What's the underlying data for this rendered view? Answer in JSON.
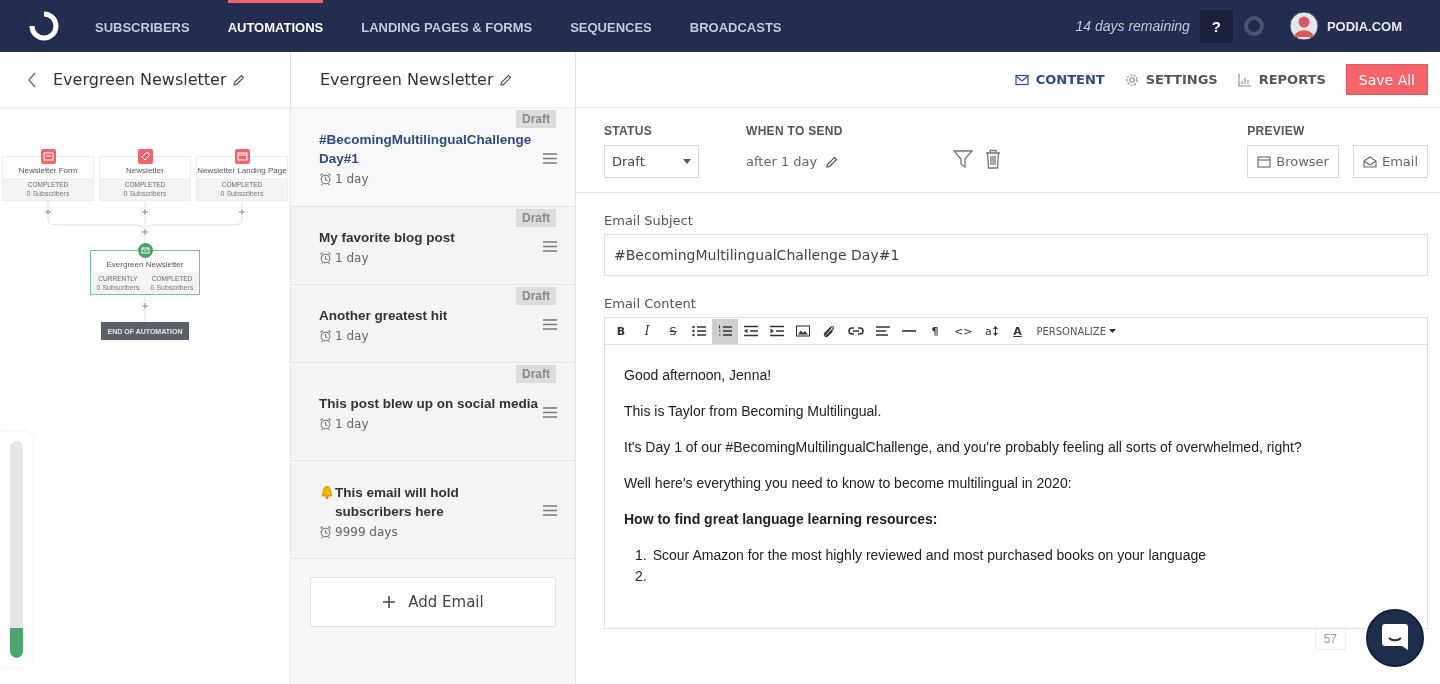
{
  "nav": {
    "items": [
      {
        "label": "SUBSCRIBERS",
        "selected": false
      },
      {
        "label": "AUTOMATIONS",
        "selected": true
      },
      {
        "label": "LANDING PAGES & FORMS",
        "selected": false
      },
      {
        "label": "SEQUENCES",
        "selected": false
      },
      {
        "label": "BROADCASTS",
        "selected": false
      }
    ],
    "trial": "14 days remaining",
    "help": "?",
    "account": "PODIA.COM"
  },
  "automation": {
    "title": "Evergreen Newsletter",
    "triggers": [
      {
        "kind": "form",
        "title": "Newsletter Form",
        "status": "COMPLETED",
        "count": "0 Subscribers"
      },
      {
        "kind": "tag",
        "title": "Newsletter",
        "status": "COMPLETED",
        "count": "0 Subscribers"
      },
      {
        "kind": "page",
        "title": "Newsletter Landing Page",
        "status": "COMPLETED",
        "count": "0 Subscribers"
      }
    ],
    "sequence": {
      "title": "Evergreen Newsletter",
      "stats": [
        {
          "label": "CURRENTLY",
          "count": "0 Subscribers"
        },
        {
          "label": "COMPLETED",
          "count": "0 Subscribers"
        }
      ]
    },
    "end": "END OF AUTOMATION",
    "progress": {
      "level": 0.14
    }
  },
  "sequence": {
    "title": "Evergreen Newsletter",
    "emails": [
      {
        "kind": "email",
        "title": "#BecomingMultilingualChallenge Day#1",
        "delay": "1 day",
        "badge": "Draft",
        "selected": true
      },
      {
        "kind": "email",
        "title": "My favorite blog post",
        "delay": "1 day",
        "badge": "Draft",
        "selected": false
      },
      {
        "kind": "email",
        "title": "Another greatest hit",
        "delay": "1 day",
        "badge": "Draft",
        "selected": false
      },
      {
        "kind": "email",
        "title": "This post blew up on social media",
        "delay": "1 day",
        "badge": "Draft",
        "selected": false
      },
      {
        "kind": "hold",
        "title": "This email will hold subscribers here",
        "delay": "9999 days",
        "selected": false
      }
    ],
    "add": "Add Email"
  },
  "tabs": [
    {
      "kind": "mail",
      "label": "CONTENT",
      "selected": true
    },
    {
      "kind": "gear",
      "label": "SETTINGS",
      "selected": false
    },
    {
      "kind": "chart",
      "label": "REPORTS",
      "selected": false
    }
  ],
  "save": "Save All",
  "status": {
    "label": "STATUS",
    "value": "Draft"
  },
  "when": {
    "label": "WHEN TO SEND",
    "value": "after 1 day"
  },
  "preview": {
    "label": "PREVIEW",
    "buttons": [
      {
        "kind": "browser",
        "label": "Browser"
      },
      {
        "kind": "email",
        "label": "Email"
      }
    ]
  },
  "subject": {
    "label": "Email Subject",
    "value": "#BecomingMultilingualChallenge Day#1"
  },
  "content": {
    "label": "Email Content",
    "toolbar": [
      {
        "kind": "bold",
        "label": "B",
        "active": false
      },
      {
        "kind": "italic",
        "label": "I",
        "active": false
      },
      {
        "kind": "strike",
        "label": "S",
        "active": false
      },
      {
        "kind": "bullets",
        "active": false
      },
      {
        "kind": "numbers",
        "active": true
      },
      {
        "kind": "outdent",
        "active": false
      },
      {
        "kind": "indent",
        "active": false
      },
      {
        "kind": "image",
        "active": false
      },
      {
        "kind": "attach",
        "active": false
      },
      {
        "kind": "link",
        "active": false
      },
      {
        "kind": "align",
        "active": false
      },
      {
        "kind": "rule",
        "active": false
      },
      {
        "kind": "para",
        "label": "¶",
        "active": false
      },
      {
        "kind": "code",
        "label": "<>",
        "active": false
      },
      {
        "kind": "size",
        "label": "a",
        "active": false
      },
      {
        "kind": "color",
        "label": "A",
        "active": false
      },
      {
        "kind": "menu",
        "label": "PERSONALIZE",
        "active": false
      }
    ],
    "blocks": [
      {
        "kind": "paragraph",
        "text": "Good afternoon, Jenna!"
      },
      {
        "kind": "paragraph",
        "text": "This is Taylor from Becoming Multilingual."
      },
      {
        "kind": "paragraph",
        "text": "It's Day 1 of our #BecomingMultilingualChallenge, and you're probably feeling all sorts of overwhelmed, right?"
      },
      {
        "kind": "paragraph",
        "text": "Well here's everything you need to know to become multilingual in 2020:"
      },
      {
        "kind": "heading",
        "text": "How to find great language learning resources:"
      },
      {
        "kind": "list",
        "items": [
          {
            "number": "1.",
            "text": "Scour Amazon for the most highly reviewed and most purchased books on your language"
          },
          {
            "number": "2."
          }
        ]
      }
    ],
    "count": "57"
  }
}
